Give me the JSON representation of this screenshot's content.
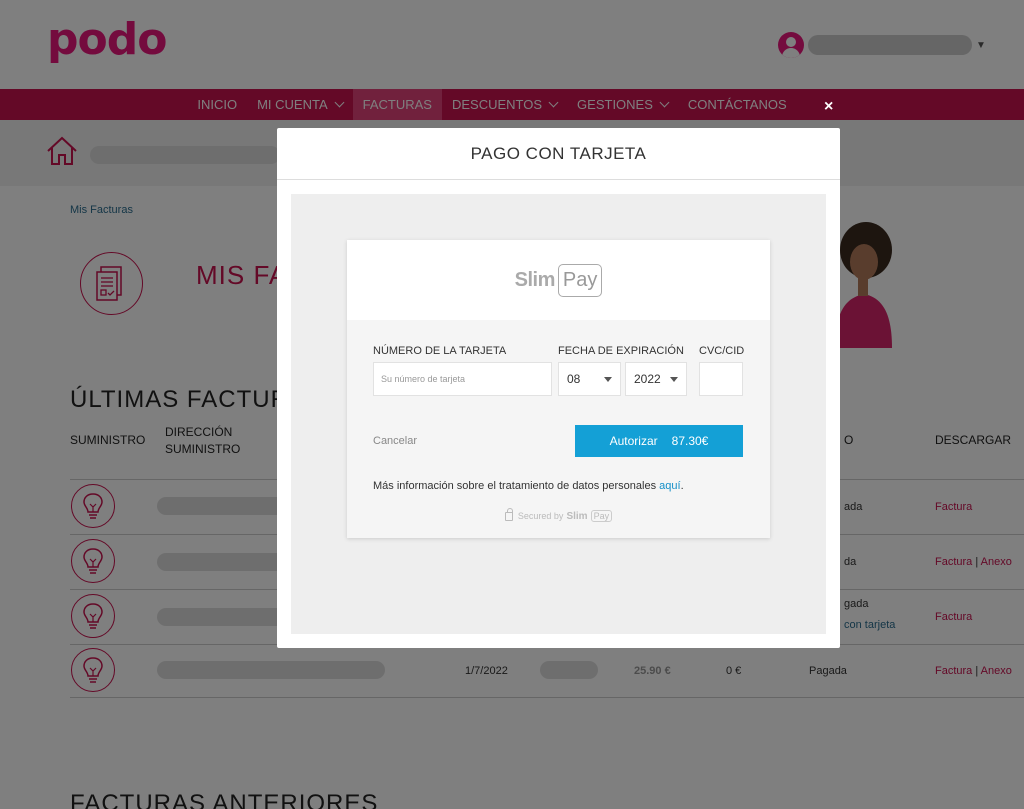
{
  "brand": {
    "logo_text": "podo",
    "primary_color": "#c8124f",
    "accent_color": "#e8177c"
  },
  "nav": {
    "items": [
      {
        "label": "INICIO",
        "dropdown": false,
        "active": false
      },
      {
        "label": "MI CUENTA",
        "dropdown": true,
        "active": false
      },
      {
        "label": "FACTURAS",
        "dropdown": false,
        "active": true
      },
      {
        "label": "DESCUENTOS",
        "dropdown": true,
        "active": false
      },
      {
        "label": "GESTIONES",
        "dropdown": true,
        "active": false
      },
      {
        "label": "CONTÁCTANOS",
        "dropdown": false,
        "active": false
      }
    ]
  },
  "breadcrumb": "Mis Facturas",
  "page_title": "MIS FA",
  "section_title": "ÚLTIMAS FACTURA",
  "table": {
    "headers": {
      "supply": "SUMINISTRO",
      "address": "DIRECCIÓN SUMINISTRO",
      "status_partial": "O",
      "download": "DESCARGAR"
    },
    "rows": [
      {
        "status": "ada",
        "status_extra": "",
        "date": "",
        "amount": "",
        "pending": "",
        "link1": "Factura",
        "link2": ""
      },
      {
        "status": "da",
        "status_extra": "",
        "date": "",
        "amount": "",
        "pending": "",
        "link1": "Factura",
        "link2": "Anexo"
      },
      {
        "status": "gada",
        "status_extra": "con tarjeta",
        "date": "",
        "amount": "",
        "pending": "",
        "link1": "Factura",
        "link2": ""
      },
      {
        "status": "Pagada",
        "status_extra": "",
        "date": "1/7/2022",
        "amount": "25.90 €",
        "pending": "0 €",
        "link1": "Factura",
        "link2": "Anexo"
      }
    ],
    "link_separator": "|"
  },
  "bottom_section_title": "FACTURAS ANTERIORES",
  "modal": {
    "title": "PAGO CON TARJETA",
    "close_icon": "×",
    "provider": {
      "name_part1": "Slim",
      "name_part2": "Pay"
    },
    "card_number": {
      "label": "NÚMERO DE LA TARJETA",
      "placeholder": "Su número de tarjeta"
    },
    "expiry": {
      "label": "FECHA DE EXPIRACIÓN",
      "month": "08",
      "year": "2022"
    },
    "cvc": {
      "label": "CVC/CID"
    },
    "cancel_label": "Cancelar",
    "authorize": {
      "label": "Autorizar",
      "amount": "87.30€",
      "color": "#14a0d6"
    },
    "info_text": "Más información sobre el tratamiento de datos personales",
    "info_link": "aquí",
    "info_end": ".",
    "secured_text": "Secured by",
    "secured_brand1": "Slim",
    "secured_brand2": "Pay"
  }
}
